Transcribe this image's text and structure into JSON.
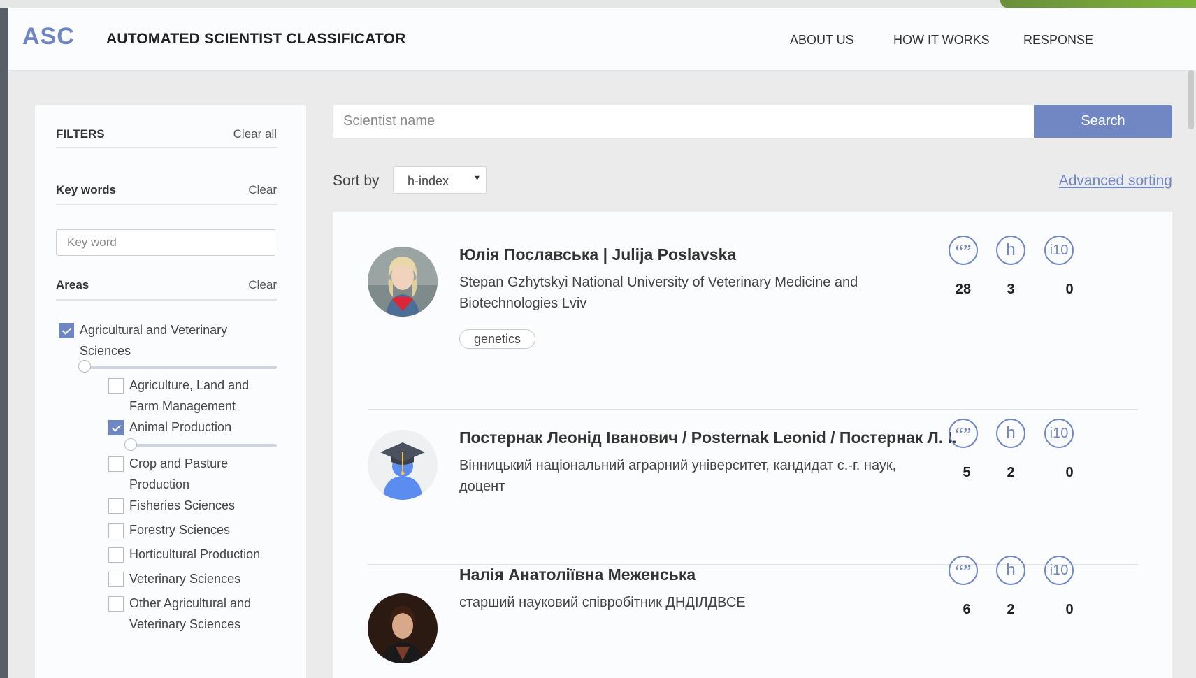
{
  "header": {
    "logo": "ASC",
    "title": "AUTOMATED SCIENTIST CLASSIFICATOR",
    "nav": [
      "ABOUT US",
      "HOW IT WORKS",
      "RESPONSE"
    ]
  },
  "filters": {
    "title": "FILTERS",
    "clear_all": "Clear all",
    "keywords_label": "Key words",
    "keywords_clear": "Clear",
    "keyword_placeholder": "Key word",
    "areas_label": "Areas",
    "areas_clear": "Clear",
    "areas": [
      {
        "label_line1": "Agricultural and Veterinary",
        "label_line2": "Sciences",
        "checked": true
      },
      {
        "label_line1": "Agriculture, Land and",
        "label_line2": "Farm Management",
        "checked": false
      },
      {
        "label_line1": "Animal Production",
        "label_line2": "",
        "checked": true
      },
      {
        "label_line1": "Crop and Pasture",
        "label_line2": "Production",
        "checked": false
      },
      {
        "label_line1": "Fisheries Sciences",
        "label_line2": "",
        "checked": false
      },
      {
        "label_line1": "Forestry Sciences",
        "label_line2": "",
        "checked": false
      },
      {
        "label_line1": "Horticultural Production",
        "label_line2": "",
        "checked": false
      },
      {
        "label_line1": "Veterinary Sciences",
        "label_line2": "",
        "checked": false
      },
      {
        "label_line1": "Other Agricultural and",
        "label_line2": "Veterinary Sciences",
        "checked": false
      }
    ]
  },
  "search": {
    "placeholder": "Scientist name",
    "button": "Search"
  },
  "sort": {
    "label": "Sort by",
    "selected": "h-index",
    "advanced": "Advanced sorting"
  },
  "metric_icons": {
    "citations": "“”",
    "h": "h",
    "i10": "i10"
  },
  "scientists": [
    {
      "name": "Юлія Пославська | Julija Poslavska",
      "affiliation": "Stepan Gzhytskyi National University of Veterinary Medicine and Biotechnologies Lviv",
      "tags": [
        "genetics"
      ],
      "citations": "28",
      "h_index": "3",
      "i10_index": "0"
    },
    {
      "name": "Постернак Леонід Іванович / Posternak Leonid / Постернак Л. І.",
      "affiliation": "Вінницький національний аграрний університет, кандидат с.-г. наук, доцент",
      "tags": [],
      "citations": "5",
      "h_index": "2",
      "i10_index": "0"
    },
    {
      "name": "Налія Анатоліївна Меженська",
      "affiliation": "старший науковий співробітник ДНДІЛДВСЕ",
      "tags": [],
      "citations": "6",
      "h_index": "2",
      "i10_index": "0"
    }
  ],
  "colors": {
    "accent": "#7187c4",
    "background": "#ebebeb",
    "panel": "#fbfcfe"
  }
}
